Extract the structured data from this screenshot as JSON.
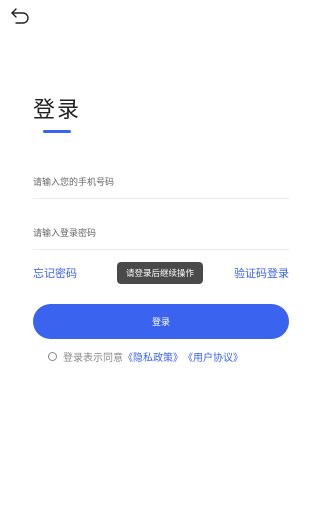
{
  "header": {
    "back_icon": "back-arrow-icon"
  },
  "title": "登录",
  "form": {
    "phone_placeholder": "请输入您的手机号码",
    "password_placeholder": "请输入登录密码"
  },
  "links": {
    "forgot_password": "忘记密码",
    "code_login": "验证码登录"
  },
  "toast": "请登录后继续操作",
  "login_button": "登录",
  "agreement": {
    "prefix": "登录表示同意",
    "privacy_policy": "《隐私政策》",
    "user_agreement": "《用户协议》"
  },
  "colors": {
    "accent": "#3a63f0",
    "toast_bg": "#4a4a4a"
  }
}
